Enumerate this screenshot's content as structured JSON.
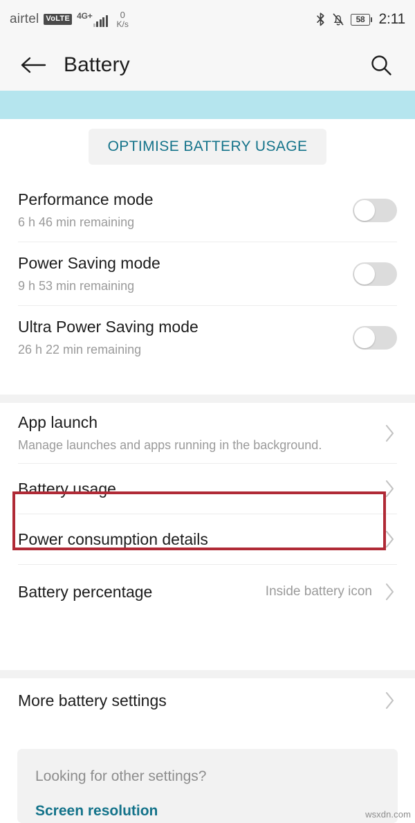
{
  "statusbar": {
    "carrier": "airtel",
    "volte_badge": "VoLTE",
    "network_type": "4G+",
    "data_speed_value": "0",
    "data_speed_unit": "K/s",
    "bluetooth_icon": "bluetooth-icon",
    "silent_icon": "bell-muted-icon",
    "battery_level": "58",
    "clock": "2:11"
  },
  "appbar": {
    "back_icon": "back-arrow-icon",
    "title": "Battery",
    "search_icon": "search-icon"
  },
  "banner": {
    "accent_color": "#b5e5ee"
  },
  "optimise": {
    "label": "OPTIMISE BATTERY USAGE",
    "text_color": "#14738a"
  },
  "modes": [
    {
      "title": "Performance mode",
      "subtitle": "6 h 46 min remaining",
      "toggle_state": "off"
    },
    {
      "title": "Power Saving mode",
      "subtitle": "9 h 53 min remaining",
      "toggle_state": "off"
    },
    {
      "title": "Ultra Power Saving mode",
      "subtitle": "26 h 22 min remaining",
      "toggle_state": "off"
    }
  ],
  "links": [
    {
      "title": "App launch",
      "subtitle": "Manage launches and apps running in the background.",
      "value": "",
      "chevron": "chevron-right-icon"
    },
    {
      "title": "Battery usage",
      "subtitle": "",
      "value": "",
      "chevron": "chevron-right-icon"
    },
    {
      "title": "Power consumption details",
      "subtitle": "",
      "value": "",
      "chevron": "chevron-right-icon"
    },
    {
      "title": "Battery percentage",
      "subtitle": "",
      "value": "Inside battery icon",
      "chevron": "chevron-right-icon"
    }
  ],
  "more_settings": {
    "title": "More battery settings",
    "chevron": "chevron-right-icon"
  },
  "footer": {
    "question": "Looking for other settings?",
    "link": "Screen resolution",
    "link_color": "#14738a"
  },
  "annotation": {
    "target": "Battery usage",
    "color": "#b02a36"
  },
  "watermark": "wsxdn.com"
}
